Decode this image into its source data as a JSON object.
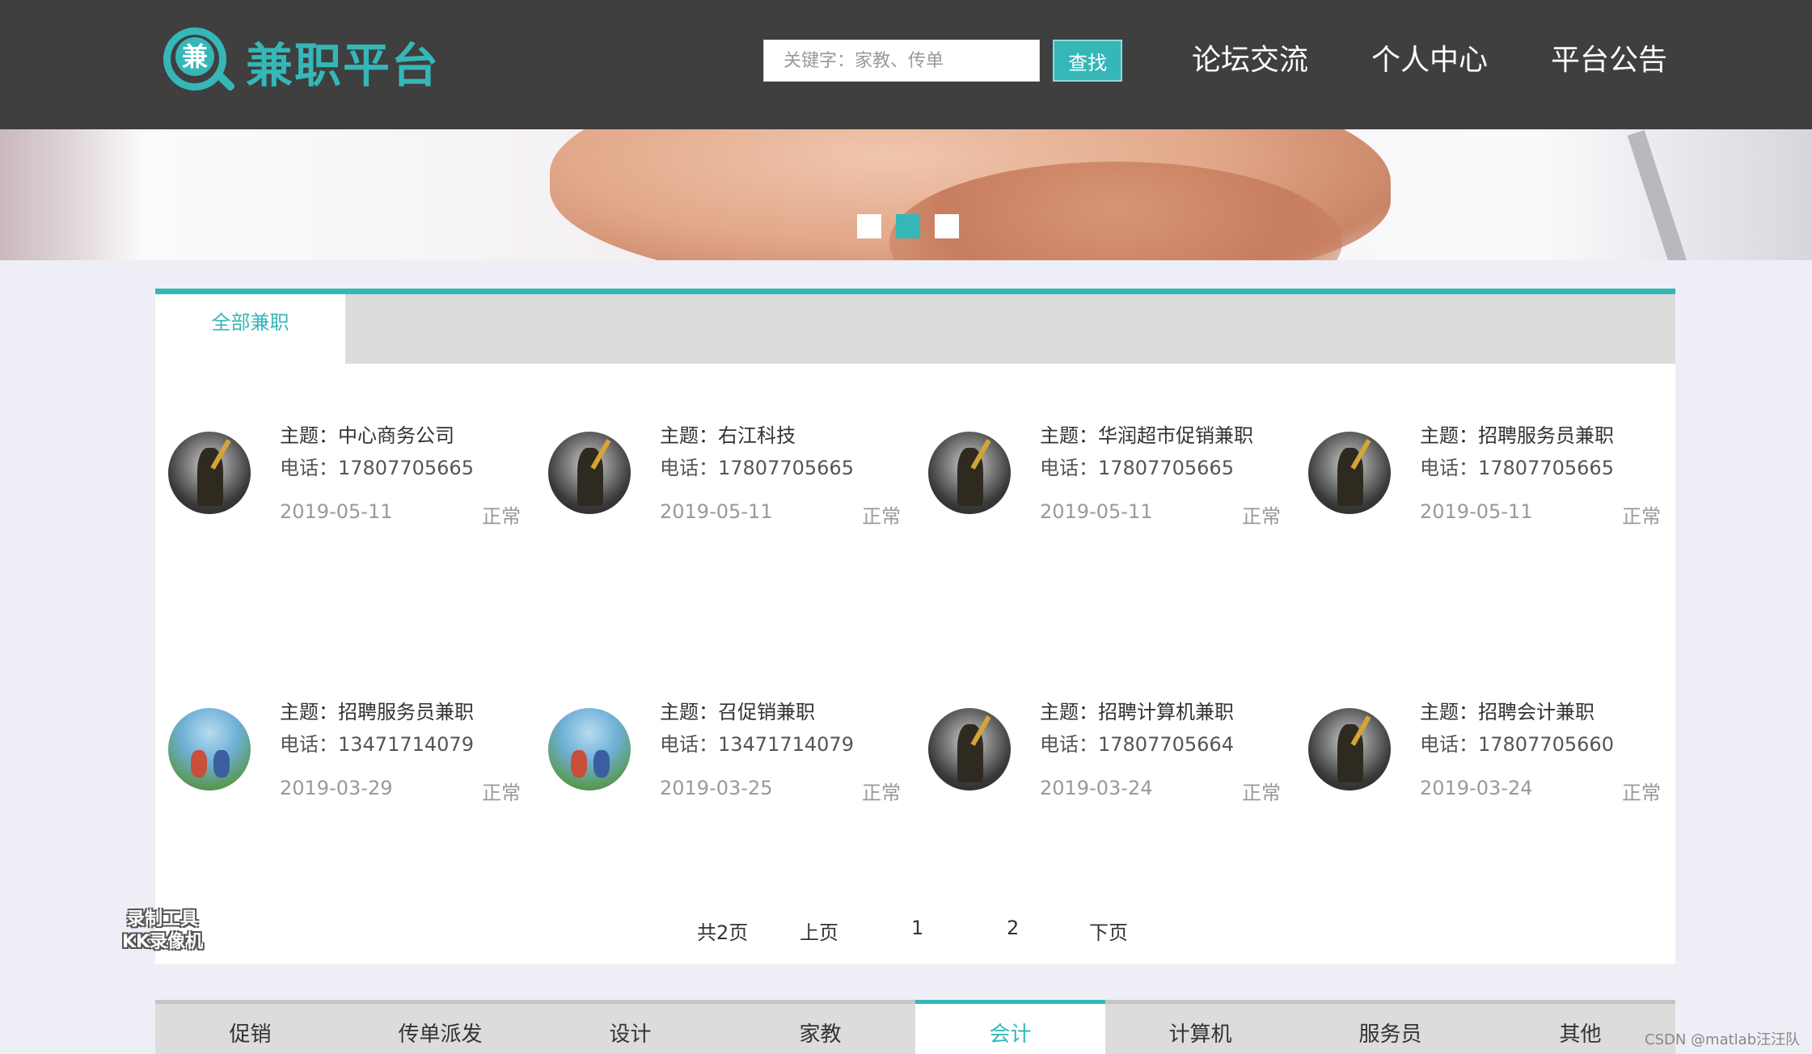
{
  "header": {
    "logo_glyph": "兼",
    "logo_text": "兼职平台",
    "search_placeholder": "关键字：家教、传单",
    "search_button": "查找",
    "nav": [
      "论坛交流",
      "个人中心",
      "平台公告"
    ]
  },
  "colors": {
    "accent": "#35b7b8",
    "header_bg": "#3f3f3f"
  },
  "banner": {
    "slide_count": 3,
    "active_slide": 2
  },
  "main": {
    "tab_label": "全部兼职",
    "jobs": [
      {
        "title": "主题：中心商务公司",
        "phone": "电话：17807705665",
        "date": "2019-05-11",
        "status": "正常",
        "avatar": "warrior-avatar"
      },
      {
        "title": "主题：右江科技",
        "phone": "电话：17807705665",
        "date": "2019-05-11",
        "status": "正常",
        "avatar": "warrior-avatar"
      },
      {
        "title": "主题：华润超市促销兼职",
        "phone": "电话：17807705665",
        "date": "2019-05-11",
        "status": "正常",
        "avatar": "warrior-avatar"
      },
      {
        "title": "主题：招聘服务员兼职",
        "phone": "电话：17807705665",
        "date": "2019-05-11",
        "status": "正常",
        "avatar": "warrior-avatar"
      },
      {
        "title": "主题：招聘服务员兼职",
        "phone": "电话：13471714079",
        "date": "2019-03-29",
        "status": "正常",
        "avatar": "kids-avatar"
      },
      {
        "title": "主题：召促销兼职",
        "phone": "电话：13471714079",
        "date": "2019-03-25",
        "status": "正常",
        "avatar": "kids-avatar"
      },
      {
        "title": "主题：招聘计算机兼职",
        "phone": "电话：17807705664",
        "date": "2019-03-24",
        "status": "正常",
        "avatar": "warrior-avatar"
      },
      {
        "title": "主题：招聘会计兼职",
        "phone": "电话：17807705660",
        "date": "2019-03-24",
        "status": "正常",
        "avatar": "warrior-avatar"
      }
    ],
    "pagination": {
      "total": "共2页",
      "prev": "上页",
      "page1": "1",
      "page2": "2",
      "next": "下页"
    }
  },
  "watermark": {
    "line1": "录制工具",
    "line2": "KK录像机"
  },
  "categories": {
    "items": [
      "促销",
      "传单派发",
      "设计",
      "家教",
      "会计",
      "计算机",
      "服务员",
      "其他"
    ],
    "active": "会计"
  },
  "credit": "CSDN @matlab汪汪队"
}
